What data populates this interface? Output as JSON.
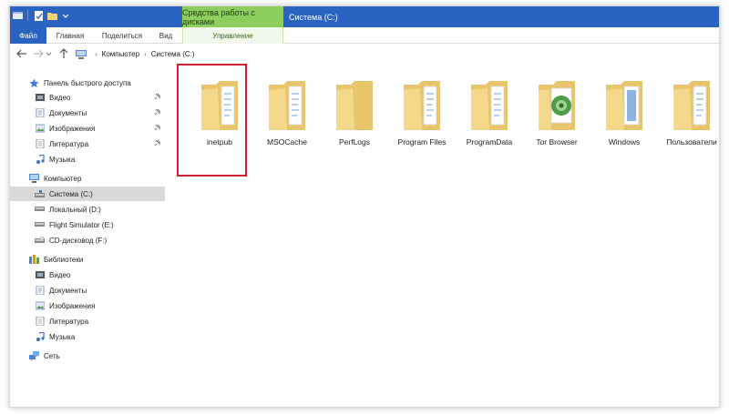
{
  "window": {
    "context_tab": "Средства работы с дисками",
    "title": "Система (C:)"
  },
  "ribbon": {
    "tabs": [
      "Файл",
      "Главная",
      "Поделиться",
      "Вид",
      "Управление"
    ]
  },
  "address": {
    "crumbs": [
      "Компьютер",
      "Система (C:)"
    ]
  },
  "nav": {
    "quick_access": "Панель быстрого доступа",
    "quick_items": [
      "Видео",
      "Документы",
      "Изображения",
      "Литература",
      "Музыка"
    ],
    "computer": "Компьютер",
    "drives": [
      "Система (C:)",
      "Локальный (D:)",
      "Flight Simulator (E:)",
      "CD-дисковод (F:)"
    ],
    "libraries": "Библиотеки",
    "library_items": [
      "Видео",
      "Документы",
      "Изображения",
      "Литература",
      "Музыка"
    ],
    "network": "Сеть"
  },
  "folders": [
    {
      "name": "inetpub",
      "icon": "folder-with-docs-icon"
    },
    {
      "name": "MSOCache",
      "icon": "folder-with-docs-icon"
    },
    {
      "name": "PerfLogs",
      "icon": "folder-icon"
    },
    {
      "name": "Program Files",
      "icon": "folder-with-docs-icon"
    },
    {
      "name": "ProgramData",
      "icon": "folder-with-docs-icon"
    },
    {
      "name": "Tor Browser",
      "icon": "folder-with-globe-icon"
    },
    {
      "name": "Windows",
      "icon": "folder-with-docs-icon"
    },
    {
      "name": "Пользователи",
      "icon": "folder-with-docs-icon"
    }
  ],
  "colors": {
    "titlebar": "#2b63c1",
    "context_tab": "#8ece5f",
    "highlight": "#d4202f",
    "folder": "#f3d37a"
  }
}
